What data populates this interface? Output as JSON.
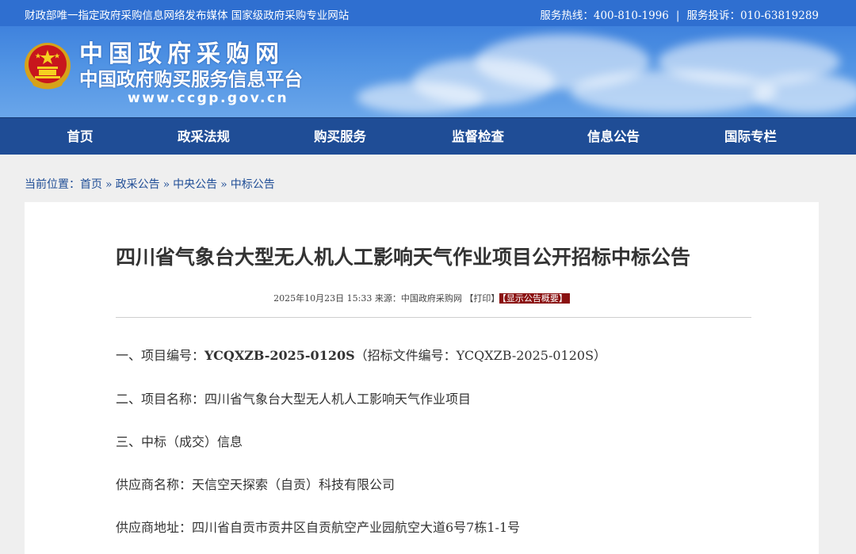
{
  "topbar": {
    "slogan": "财政部唯一指定政府采购信息网络发布媒体 国家级政府采购专业网站",
    "hotline": "服务热线：400-810-1996",
    "separator": "|",
    "complaint": "服务投诉：010-63819289"
  },
  "banner": {
    "logo_line1": "中国政府采购网",
    "logo_line2": "中国政府购买服务信息平台",
    "logo_url": "www.ccgp.gov.cn"
  },
  "nav": {
    "items": [
      {
        "label": "首页"
      },
      {
        "label": "政采法规"
      },
      {
        "label": "购买服务"
      },
      {
        "label": "监督检查"
      },
      {
        "label": "信息公告"
      },
      {
        "label": "国际专栏"
      }
    ]
  },
  "breadcrumb": {
    "prefix": "当前位置：",
    "items": [
      "首页",
      "政采公告",
      "中央公告",
      "中标公告"
    ],
    "separator": "»"
  },
  "article": {
    "title": "四川省气象台大型无人机人工影响天气作业项目公开招标中标公告",
    "datetime": "2025年10月23日 15:33",
    "source": "来源：中国政府采购网",
    "print": "【打印】",
    "summary_button": "【显示公告概要】",
    "p1_label": "一、项目编号：",
    "p1_code": "YCQXZB-2025-0120S",
    "p1_rest": "（招标文件编号：YCQXZB-2025-0120S）",
    "p2": "二、项目名称：四川省气象台大型无人机人工影响天气作业项目",
    "p3": "三、中标（成交）信息",
    "p4": "供应商名称：天信空天探索（自贡）科技有限公司",
    "p5": "供应商地址：四川省自贡市贡井区自贡航空产业园航空大道6号7栋1-1号"
  },
  "colors": {
    "topbar": "#2f6fd0",
    "nav": "#1f4d96",
    "badge": "#8a1111"
  }
}
